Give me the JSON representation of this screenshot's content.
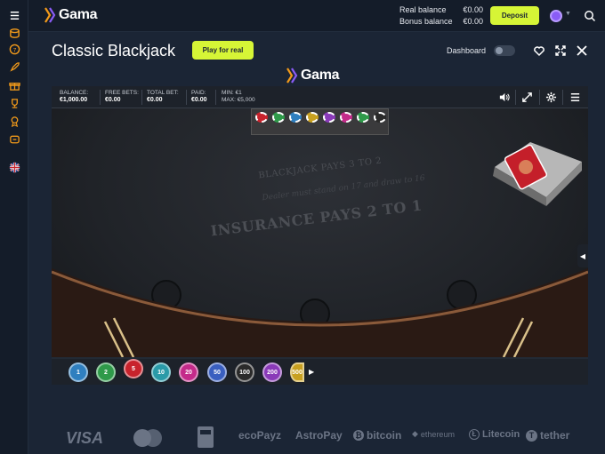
{
  "brand": {
    "name": "Gama"
  },
  "sidebar": {
    "items": [
      {
        "icon": "menu-icon"
      },
      {
        "icon": "coins-icon"
      },
      {
        "icon": "slot-icon"
      },
      {
        "icon": "rocket-icon"
      },
      {
        "icon": "gift-icon"
      },
      {
        "icon": "trophy-icon"
      },
      {
        "icon": "badge-icon"
      },
      {
        "icon": "chat-icon"
      },
      {
        "icon": "uk-flag-icon"
      }
    ]
  },
  "topbar": {
    "real_balance_label": "Real balance",
    "real_balance_value": "€0.00",
    "bonus_balance_label": "Bonus balance",
    "bonus_balance_value": "€0.00",
    "deposit_label": "Deposit"
  },
  "page": {
    "title": "Classic Blackjack",
    "play_real_label": "Play for real",
    "dashboard_label": "Dashboard"
  },
  "hud": {
    "balance_label": "BALANCE:",
    "balance_value": "€1,000.00",
    "free_bets_label": "FREE BETS:",
    "free_bets_value": "€0.00",
    "total_bet_label": "TOTAL BET:",
    "total_bet_value": "€0.00",
    "paid_label": "PAID:",
    "paid_value": "€0.00",
    "min_text": "MIN: €1",
    "max_text": "MAX: €5,000"
  },
  "felt": {
    "line1": "BLACKJACK PAYS 3 TO 2",
    "line2": "Dealer must stand on 17 and draw to 16",
    "line3": "INSURANCE PAYS 2 TO 1"
  },
  "chips": [
    {
      "label": "1",
      "color": "#2f7fbf"
    },
    {
      "label": "2",
      "color": "#2f9a4a"
    },
    {
      "label": "5",
      "color": "#c8232c"
    },
    {
      "label": "10",
      "color": "#2a9aa8"
    },
    {
      "label": "20",
      "color": "#c42b8a"
    },
    {
      "label": "50",
      "color": "#3a5fc0"
    },
    {
      "label": "100",
      "color": "#2a2a2a"
    },
    {
      "label": "200",
      "color": "#8a3ab8"
    },
    {
      "label": "500",
      "color": "#c8a020"
    }
  ],
  "payments": [
    "VISA",
    "ecoPayz",
    "AstroPay",
    "bitcoin",
    "ethereum",
    "Litecoin",
    "tether"
  ],
  "colors": {
    "accent": "#d6f536",
    "bg": "#1b2535"
  }
}
